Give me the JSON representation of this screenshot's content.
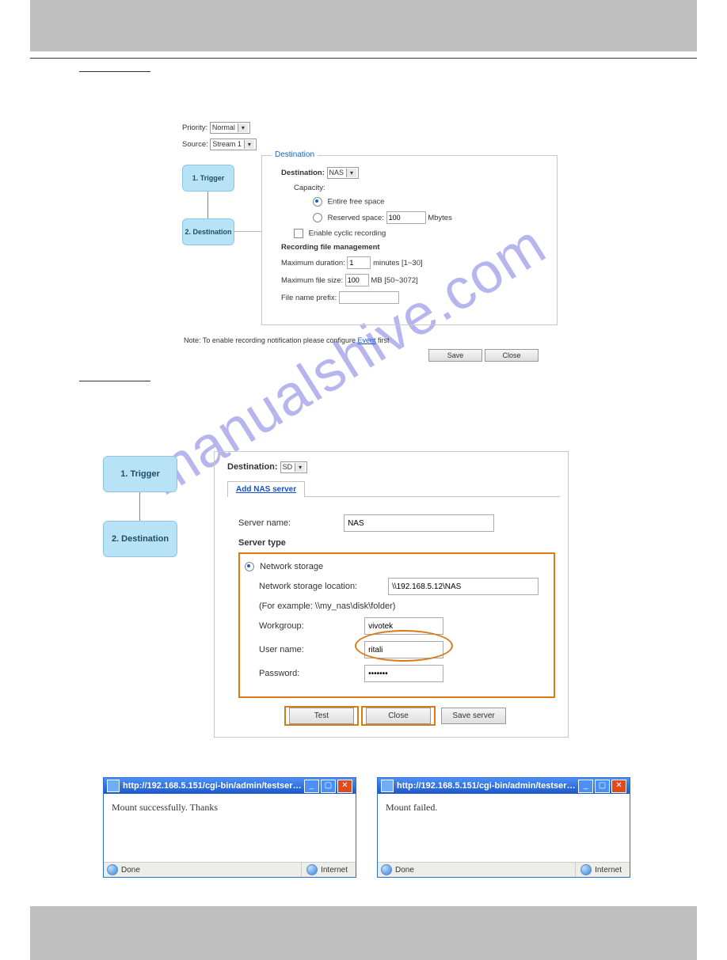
{
  "watermark": "manualshive.com",
  "fig1": {
    "priority_label": "Priority:",
    "priority_value": "Normal",
    "source_label": "Source:",
    "source_value": "Stream 1",
    "step1": "1. Trigger",
    "step2": "2. Destination",
    "legend": "Destination",
    "dest_label": "Destination:",
    "dest_value": "NAS",
    "capacity_label": "Capacity:",
    "cap_opt1": "Entire free space",
    "cap_opt2": "Reserved space:",
    "reserved_value": "100",
    "reserved_unit": "Mbytes",
    "cyclic_label": "Enable cyclic recording",
    "rec_heading": "Recording file management",
    "maxdur_label": "Maximum duration:",
    "maxdur_value": "1",
    "maxdur_unit": "minutes [1~30]",
    "maxsize_label": "Maximum file size:",
    "maxsize_value": "100",
    "maxsize_unit": "MB [50~3072]",
    "prefix_label": "File name prefix:",
    "note_pre": "Note: To enable recording notification please configure ",
    "note_link": "Event",
    "note_post": " first",
    "btn_save": "Save",
    "btn_close": "Close"
  },
  "fig2": {
    "step1": "1. Trigger",
    "step2": "2. Destination",
    "dest_label": "Destination:",
    "dest_value": "SD",
    "tab_label": "Add NAS server",
    "server_name_label": "Server name:",
    "server_name_value": "NAS",
    "server_type_heading": "Server type",
    "ns_label": "Network storage",
    "ns_loc_label": "Network storage location:",
    "ns_loc_value": "\\\\192.168.5.12\\NAS",
    "ns_example": "(For example: \\\\my_nas\\disk\\folder)",
    "workgroup_label": "Workgroup:",
    "workgroup_value": "vivotek",
    "user_label": "User name:",
    "user_value": "ritali",
    "pass_label": "Password:",
    "pass_value": "•••••••",
    "btn_test": "Test",
    "btn_close": "Close",
    "btn_save": "Save server"
  },
  "dialogs": {
    "url": "http://192.168.5.151/cgi-bin/admin/testserver...",
    "left_body": "Mount successfully. Thanks",
    "right_body": "Mount failed.",
    "done": "Done",
    "internet": "Internet"
  }
}
